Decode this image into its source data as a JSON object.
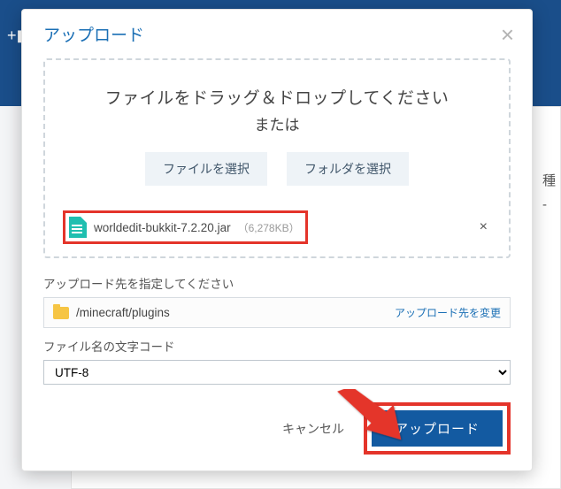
{
  "background": {
    "right_col_1": "種",
    "right_col_2": "-"
  },
  "modal": {
    "title": "アップロード"
  },
  "dropzone": {
    "big_text": "ファイルをドラッグ＆ドロップしてください",
    "or_text": "または",
    "select_file_btn": "ファイルを選択",
    "select_folder_btn": "フォルダを選択"
  },
  "file": {
    "name": "worldedit-bukkit-7.2.20.jar",
    "size": "（6,278KB）"
  },
  "destination": {
    "label": "アップロード先を指定してください",
    "path": "/minecraft/plugins",
    "change_link": "アップロード先を変更"
  },
  "encoding": {
    "label": "ファイル名の文字コード",
    "value": "UTF-8"
  },
  "footer": {
    "cancel": "キャンセル",
    "upload": "アップロード"
  }
}
